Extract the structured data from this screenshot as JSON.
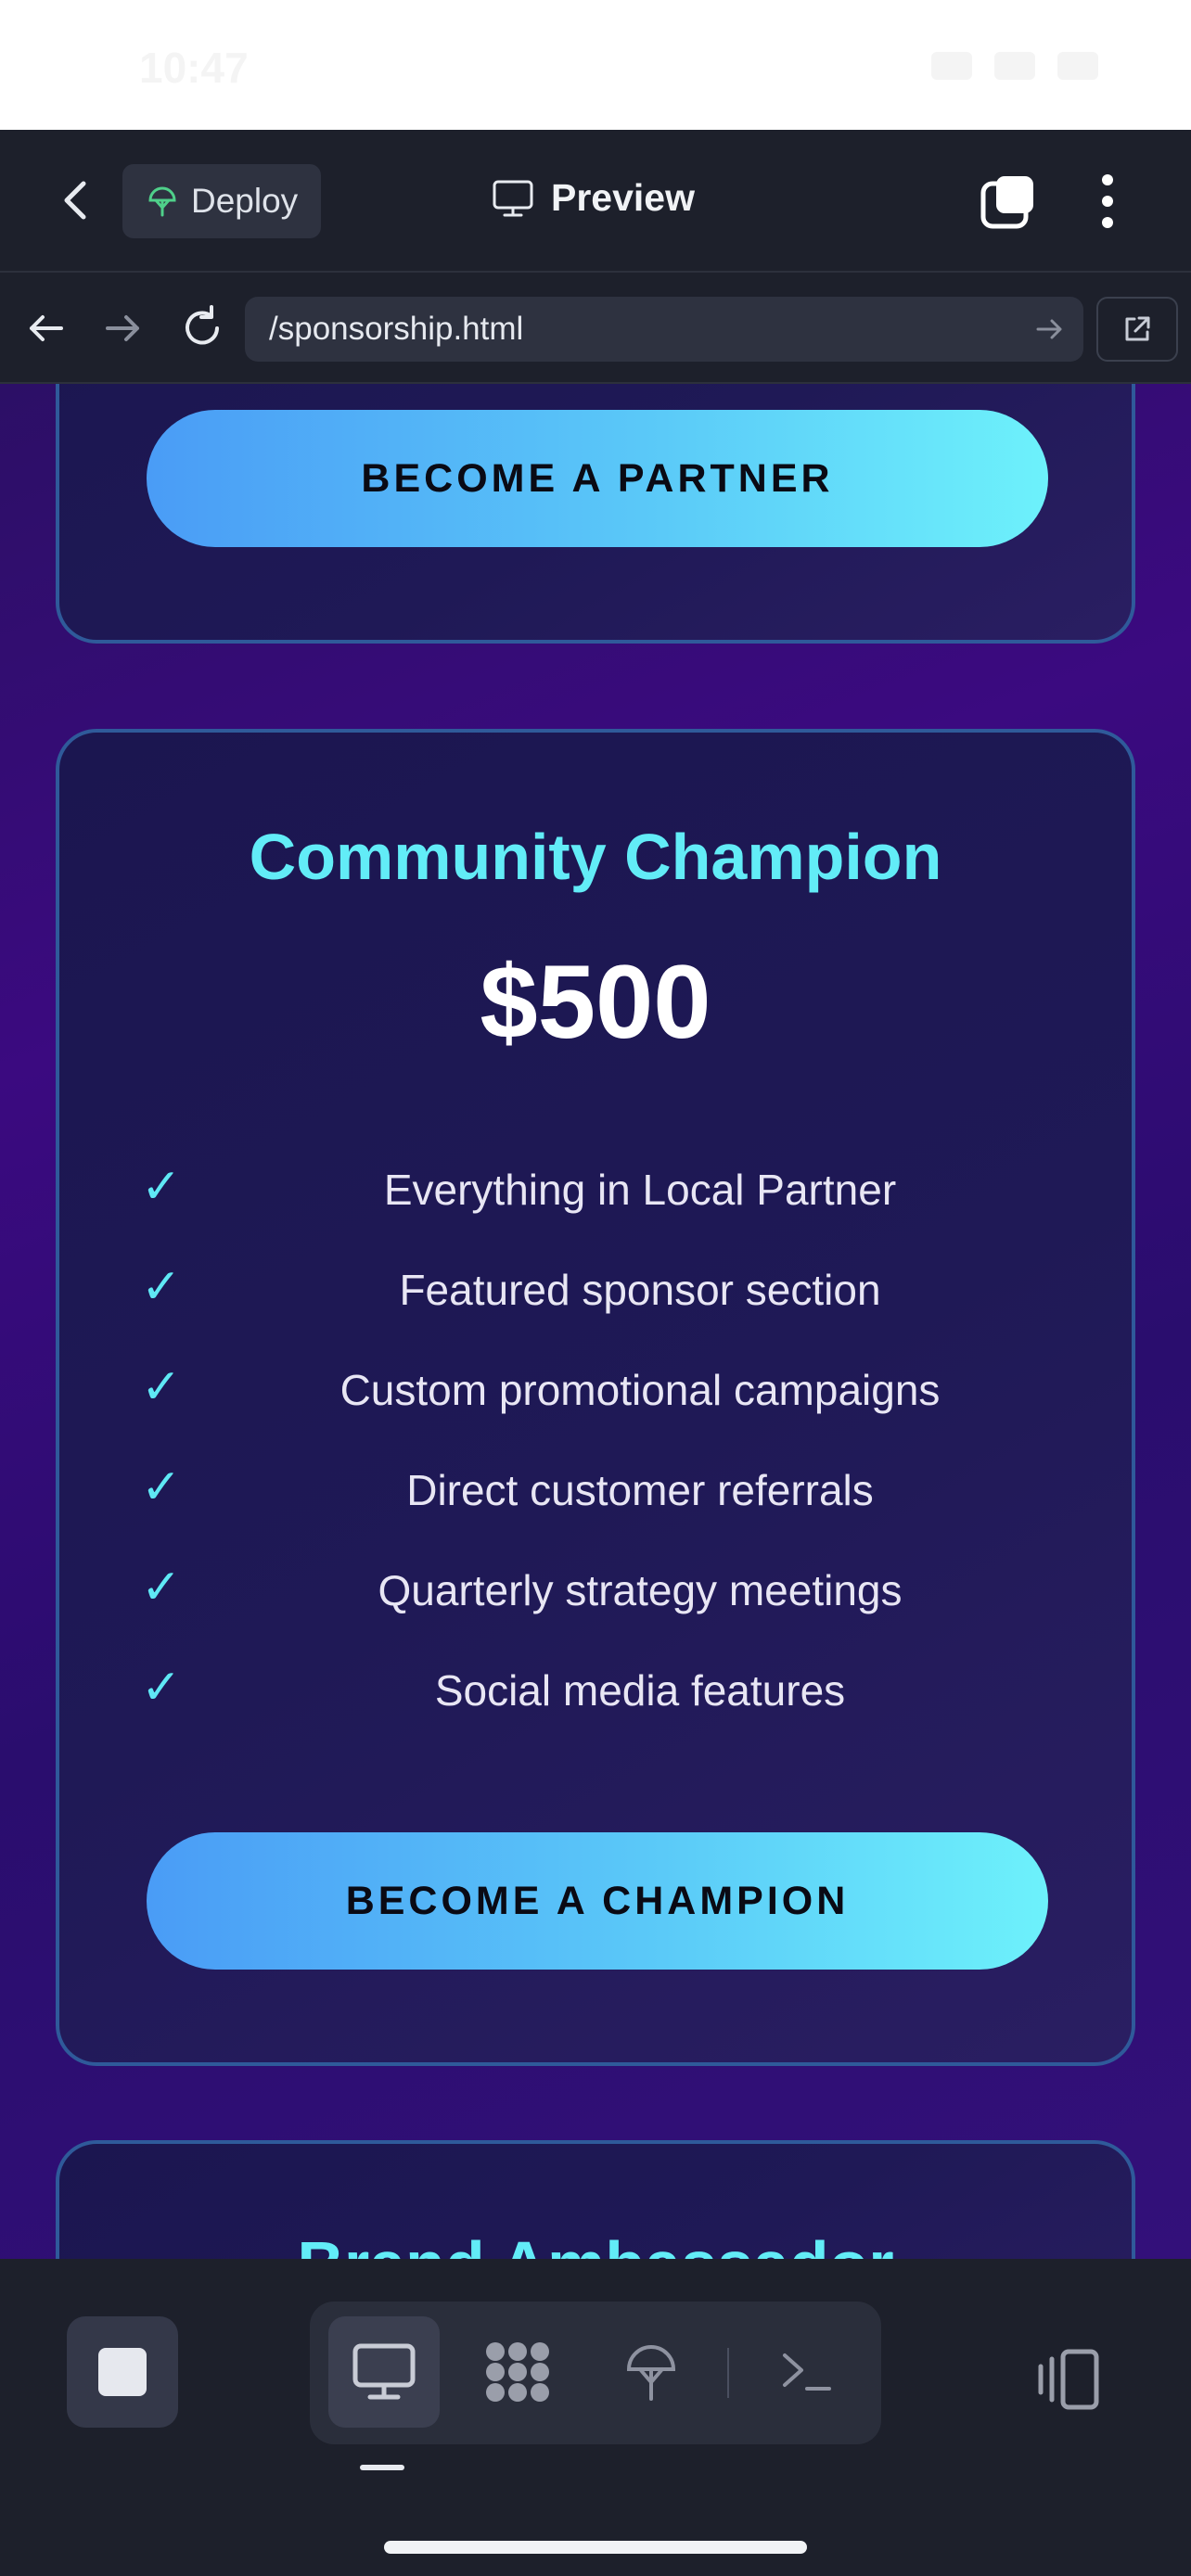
{
  "status_bar": {
    "time": "10:47"
  },
  "browser": {
    "deploy_label": "Deploy",
    "preview_label": "Preview",
    "url": "/sponsorship.html"
  },
  "page": {
    "partner_card": {
      "cta_label": "BECOME A PARTNER"
    },
    "champion_card": {
      "name": "Community Champion",
      "price": "$500",
      "check_mark": "✓",
      "features": [
        "Everything in Local Partner",
        "Featured sponsor section",
        "Custom promotional campaigns",
        "Direct customer referrals",
        "Quarterly strategy meetings",
        "Social media features"
      ],
      "cta_label": "BECOME A CHAMPION"
    },
    "ambassador_card": {
      "name": "Brand Ambassador"
    }
  },
  "toolbar": {
    "tools": [
      "preview-tool",
      "apps-tool",
      "deploy-tool",
      "terminal-tool"
    ],
    "active_tool": "preview-tool"
  },
  "colors": {
    "accent_cyan": "#62ecf7",
    "button_gradient_start": "#4a9cf6",
    "button_gradient_end": "#6df1fb",
    "page_background": "#3b0a80",
    "card_border": "#2f5a9a",
    "chrome_background": "#1d202b"
  }
}
